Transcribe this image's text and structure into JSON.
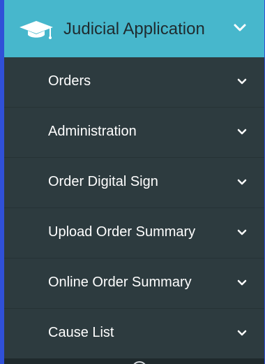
{
  "header": {
    "title": "Judicial Application",
    "icon": "graduation-cap-icon",
    "chevron_icon": "chevron-down-icon"
  },
  "menu": {
    "items": [
      {
        "label": "Orders"
      },
      {
        "label": "Administration"
      },
      {
        "label": "Order Digital Sign"
      },
      {
        "label": "Upload Order Summary"
      },
      {
        "label": "Online Order Summary"
      },
      {
        "label": "Cause List"
      }
    ],
    "chevron_icon": "chevron-down-icon"
  },
  "colors": {
    "accent": "#47b7cc",
    "panel_background": "#2d3b3f",
    "frame_background": "#3050d8",
    "text": "#ffffff"
  }
}
